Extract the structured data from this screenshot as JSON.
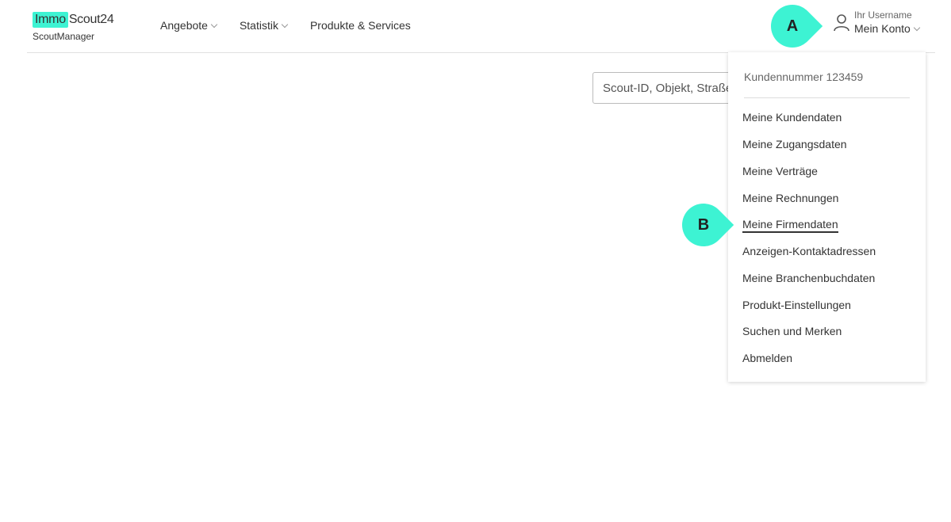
{
  "header": {
    "logo": {
      "immo": "Immo",
      "scout": "Scout24",
      "sub": "ScoutManager"
    },
    "nav": [
      {
        "label": "Angebote",
        "has_dropdown": true
      },
      {
        "label": "Statistik",
        "has_dropdown": true
      },
      {
        "label": "Produkte & Services",
        "has_dropdown": false
      }
    ],
    "account": {
      "username": "Ihr Username",
      "label": "Mein Konto",
      "icon": "user-icon"
    }
  },
  "search": {
    "placeholder": "Scout-ID, Objekt, Straße"
  },
  "dropdown": {
    "customer_number": "Kundennummer 123459",
    "items": [
      {
        "label": "Meine Kundendaten"
      },
      {
        "label": "Meine Zugangsdaten"
      },
      {
        "label": "Meine Verträge"
      },
      {
        "label": "Meine Rechnungen"
      },
      {
        "label": "Meine Firmendaten",
        "active": true
      },
      {
        "label": "Anzeigen-Kontaktadressen"
      },
      {
        "label": "Meine Branchenbuchdaten"
      },
      {
        "label": "Produkt-Einstellungen"
      },
      {
        "label": "Suchen und Merken"
      },
      {
        "label": "Abmelden"
      }
    ]
  },
  "markers": [
    {
      "label": "A"
    },
    {
      "label": "B"
    }
  ],
  "colors": {
    "accent": "#3df3d3",
    "text": "#333333",
    "muted": "#666666",
    "border": "#e0e0e0"
  }
}
